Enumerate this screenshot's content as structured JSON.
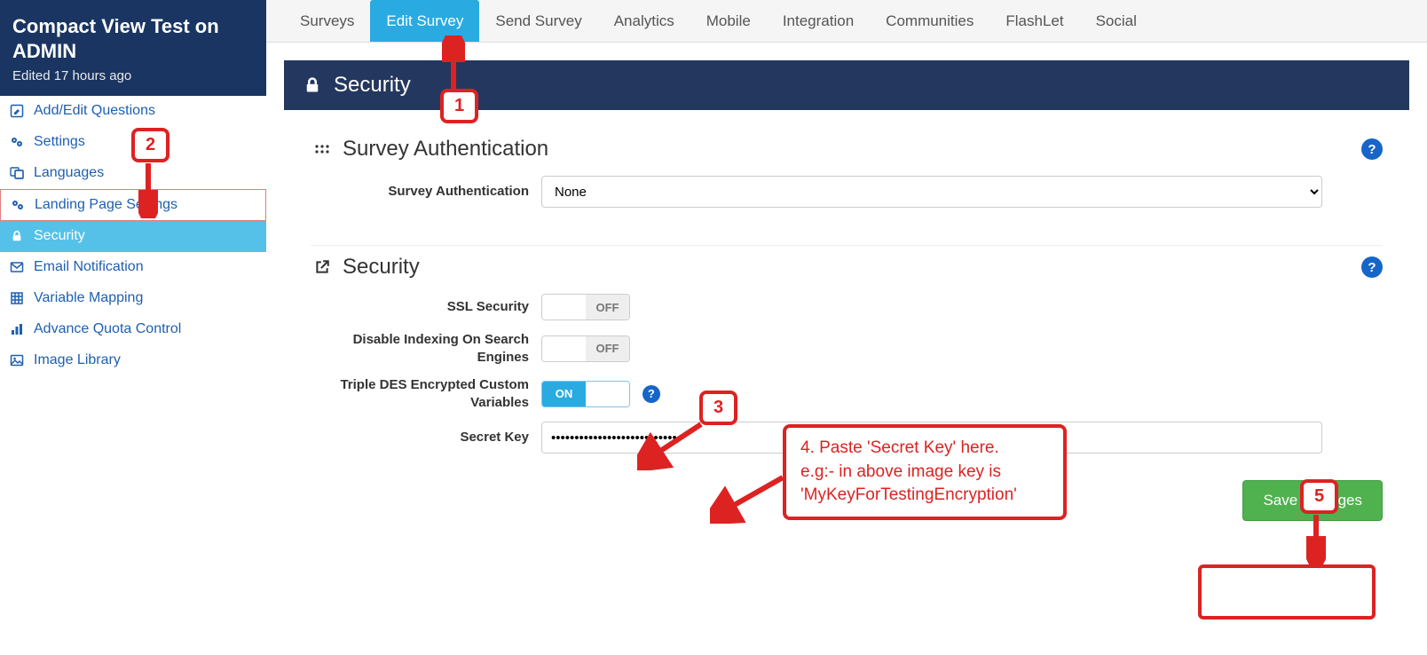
{
  "sidebar": {
    "title": "Compact View Test on ADMIN",
    "sub": "Edited 17 hours ago",
    "items": [
      {
        "label": "Add/Edit Questions",
        "icon": "edit-icon"
      },
      {
        "label": "Settings",
        "icon": "gears-icon"
      },
      {
        "label": "Languages",
        "icon": "language-icon"
      },
      {
        "label": "Landing Page Settings",
        "icon": "gears-icon"
      },
      {
        "label": "Security",
        "icon": "lock-icon"
      },
      {
        "label": "Email Notification",
        "icon": "mail-icon"
      },
      {
        "label": "Variable Mapping",
        "icon": "grid-icon"
      },
      {
        "label": "Advance Quota Control",
        "icon": "bars-icon"
      },
      {
        "label": "Image Library",
        "icon": "image-icon"
      }
    ]
  },
  "topnav": {
    "tabs": [
      "Surveys",
      "Edit Survey",
      "Send Survey",
      "Analytics",
      "Mobile",
      "Integration",
      "Communities",
      "FlashLet",
      "Social"
    ],
    "active": "Edit Survey"
  },
  "page": {
    "title": "Security"
  },
  "auth_section": {
    "title": "Survey Authentication",
    "label": "Survey Authentication",
    "value": "None"
  },
  "security_section": {
    "title": "Security",
    "ssl": {
      "label": "SSL Security",
      "state": "OFF"
    },
    "index": {
      "label": "Disable Indexing On Search Engines",
      "state": "OFF"
    },
    "tdes": {
      "label": "Triple DES Encrypted Custom Variables",
      "state": "ON"
    },
    "secret": {
      "label": "Secret Key",
      "value": "•••••••••••••••••••••••••••"
    }
  },
  "buttons": {
    "save": "Save Changes"
  },
  "toggle_text": {
    "on": "ON",
    "off": "OFF"
  },
  "annotations": {
    "c1": "1",
    "c2": "2",
    "c3": "3",
    "c5": "5",
    "note": "4. Paste 'Secret Key' here.\ne.g:- in above image key is\n'MyKeyForTestingEncryption'"
  }
}
